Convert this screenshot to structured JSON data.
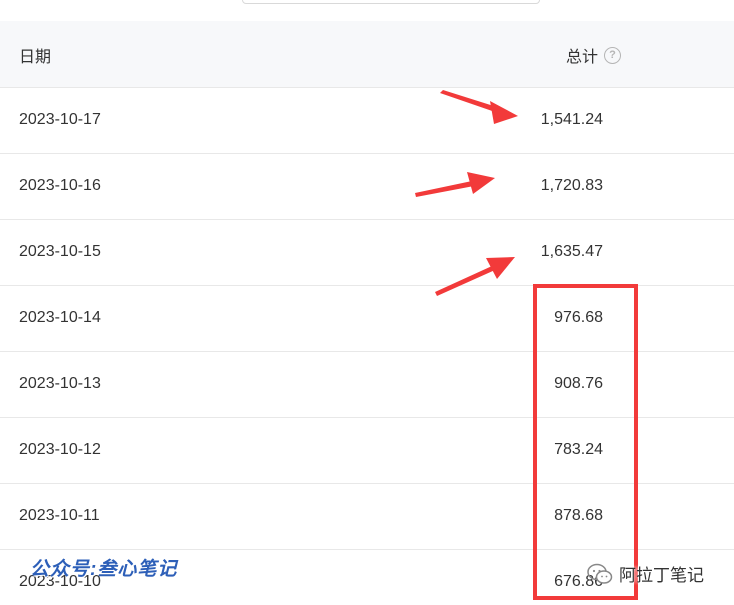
{
  "table": {
    "headers": {
      "date": "日期",
      "total": "总计",
      "help_icon": "?"
    },
    "rows": [
      {
        "date": "2023-10-17",
        "total": "1,541.24"
      },
      {
        "date": "2023-10-16",
        "total": "1,720.83"
      },
      {
        "date": "2023-10-15",
        "total": "1,635.47"
      },
      {
        "date": "2023-10-14",
        "total": "976.68"
      },
      {
        "date": "2023-10-13",
        "total": "908.76"
      },
      {
        "date": "2023-10-12",
        "total": "783.24"
      },
      {
        "date": "2023-10-11",
        "total": "878.68"
      },
      {
        "date": "2023-10-10",
        "total": "676.86"
      }
    ]
  },
  "annotations": {
    "arrow_color": "#f23a3a",
    "box_color": "#f23a3a"
  },
  "watermarks": {
    "left": "公众号:叁心笔记",
    "right": "阿拉丁笔记",
    "right_icon": "wechat-icon"
  }
}
